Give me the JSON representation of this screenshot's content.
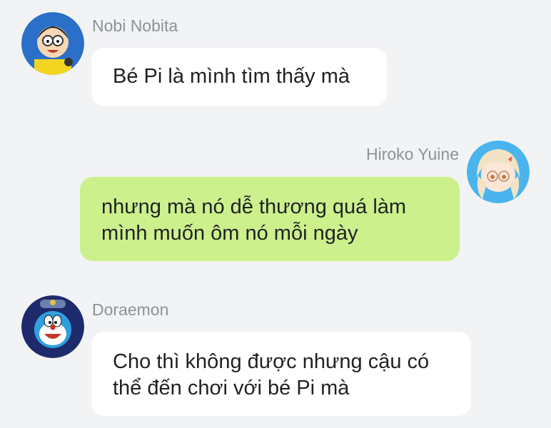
{
  "messages": [
    {
      "sender": "Nobi Nobita",
      "avatar_icon": "nobita-avatar-icon",
      "text": "Bé Pi là mình tìm thấy mà",
      "direction": "incoming"
    },
    {
      "sender": "Hiroko Yuine",
      "avatar_icon": "hiroko-avatar-icon",
      "text": "nhưng mà nó dễ thương quá làm mình muốn ôm nó mỗi ngày",
      "direction": "outgoing"
    },
    {
      "sender": "Doraemon",
      "avatar_icon": "doraemon-avatar-icon",
      "text": "Cho thì không được nhưng cậu có thể đến chơi với bé Pi mà",
      "direction": "incoming"
    }
  ],
  "colors": {
    "background": "#f2f3f5",
    "incoming_bubble": "#ffffff",
    "outgoing_bubble": "#ccf08c",
    "sender_name": "#8e9196",
    "message_text": "#1f2124"
  }
}
